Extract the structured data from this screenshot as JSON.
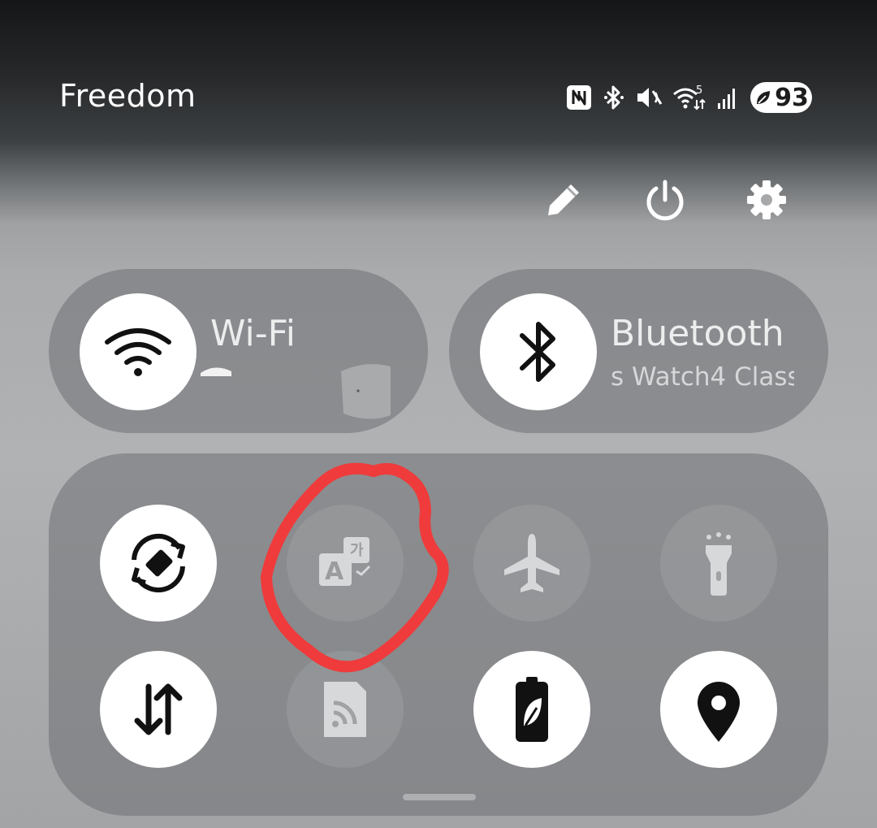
{
  "status_bar": {
    "carrier": "Freedom",
    "battery_level": "93",
    "icons": [
      "nfc-icon",
      "bluetooth-icon",
      "mute-icon",
      "wifi-5-icon",
      "signal-icon",
      "battery-saver-icon"
    ]
  },
  "top_actions": {
    "edit": "pencil-icon",
    "power": "power-icon",
    "settings": "gear-icon"
  },
  "wifi_toggle": {
    "title": "Wi-Fi",
    "state": "on"
  },
  "bluetooth_toggle": {
    "title": "Bluetooth",
    "subtitle": "s Watch4 Class",
    "state": "on"
  },
  "quick_tiles": [
    {
      "icon": "auto-rotate-icon",
      "state": "on"
    },
    {
      "icon": "translate-icon",
      "state": "off"
    },
    {
      "icon": "airplane-icon",
      "state": "off"
    },
    {
      "icon": "flashlight-icon",
      "state": "off"
    },
    {
      "icon": "mobile-data-icon",
      "state": "on"
    },
    {
      "icon": "cast-icon",
      "state": "off"
    },
    {
      "icon": "power-saving-icon",
      "state": "on"
    },
    {
      "icon": "location-icon",
      "state": "on"
    }
  ],
  "colors": {
    "tile_on": "#ffffff",
    "tile_off": "#a0a2a4",
    "annotation_circle": "#ef3b3b",
    "icon_dark": "#111111"
  }
}
